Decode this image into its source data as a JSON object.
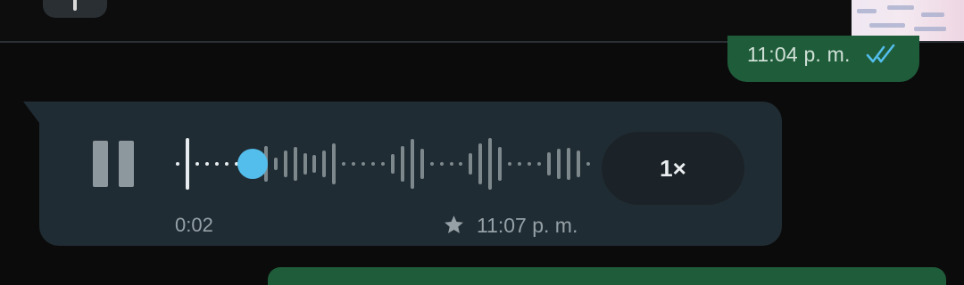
{
  "outgoing_message": {
    "timestamp": "11:04 p. m.",
    "read_receipt_icon": "double-check-icon",
    "read_receipt_color": "#53bdeb"
  },
  "voice_message": {
    "state": "playing",
    "elapsed": "0:02",
    "progress_fraction": 0.19,
    "playback_speed": "1×",
    "timestamp": "11:07 p. m.",
    "starred_icon": "star-icon",
    "pause_icon": "pause-icon"
  },
  "colors": {
    "bubble_incoming": "#202c33",
    "bubble_outgoing": "#1f5c3a",
    "progress_knob": "#53bdeb",
    "background": "#0b0b0b"
  }
}
